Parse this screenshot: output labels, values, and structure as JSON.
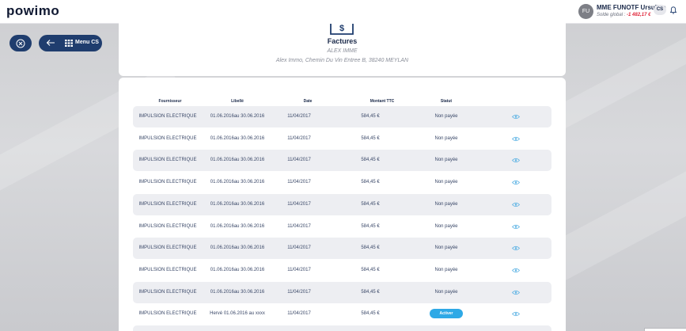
{
  "app": {
    "logo": "powimo"
  },
  "user": {
    "initials": "FU",
    "name": "MME FUNOTF Ursuline",
    "balance_label": "Solde global :",
    "balance_value": "-1 482,17 €",
    "role_badge": "CS"
  },
  "nav": {
    "menu_label": "Menu CS"
  },
  "invoice_header": {
    "title": "Factures",
    "company": "ALEX IMME",
    "address": "Alex Immo, Chemin Du Vin Entree B, 38240 MEYLAN"
  },
  "table": {
    "headers": [
      "Fournisseur",
      "Libellé",
      "Date",
      "Montant TTC",
      "Statut"
    ],
    "rows": [
      {
        "fournisseur": "IMPULSION ELECTRIQUE",
        "libelle": "01.06.2016au 30.06.2016",
        "date": "11/04/2017",
        "montant": "584,45 €",
        "statut": "Non payée"
      },
      {
        "fournisseur": "IMPULSION ELECTRIQUE",
        "libelle": "01.06.2016au 30.06.2016",
        "date": "11/04/2017",
        "montant": "584,45 €",
        "statut": "Non payée"
      },
      {
        "fournisseur": "IMPULSION ELECTRIQUE",
        "libelle": "01.06.2016au 30.06.2016",
        "date": "11/04/2017",
        "montant": "584,45 €",
        "statut": "Non payée"
      },
      {
        "fournisseur": "IMPULSION ELECTRIQUE",
        "libelle": "01.06.2016au 30.06.2016",
        "date": "11/04/2017",
        "montant": "584,45 €",
        "statut": "Non payée"
      },
      {
        "fournisseur": "IMPULSION ELECTRIQUE",
        "libelle": "01.06.2016au 30.06.2016",
        "date": "11/04/2017",
        "montant": "584,45 €",
        "statut": "Non payée"
      },
      {
        "fournisseur": "IMPULSION ELECTRIQUE",
        "libelle": "01.06.2016au 30.06.2016",
        "date": "11/04/2017",
        "montant": "584,45 €",
        "statut": "Non payée"
      },
      {
        "fournisseur": "IMPULSION ELECTRIQUE",
        "libelle": "01.06.2016au 30.06.2016",
        "date": "11/04/2017",
        "montant": "584,45 €",
        "statut": "Non payée"
      },
      {
        "fournisseur": "IMPULSION ELECTRIQUE",
        "libelle": "01.06.2016au 30.06.2016",
        "date": "11/04/2017",
        "montant": "584,45 €",
        "statut": "Non payée"
      },
      {
        "fournisseur": "IMPULSION ELECTRIQUE",
        "libelle": "01.06.2016au 30.06.2016",
        "date": "11/04/2017",
        "montant": "584,45 €",
        "statut": "Non payée"
      },
      {
        "fournisseur": "IMPULSION ELECTRIQUE",
        "libelle": "Hervé 01.06.2016 au xxxx",
        "date": "11/04/2017",
        "montant": "584,45 €",
        "statut": "Activer"
      }
    ]
  },
  "colors": {
    "navy": "#1f3d6e",
    "accent_blue": "#2ea9e6",
    "negative_red": "#e0263a"
  },
  "icons": [
    "close-circle-icon",
    "arrow-left-icon",
    "grid-icon",
    "bell-icon",
    "invoice-icon",
    "eye-icon"
  ]
}
